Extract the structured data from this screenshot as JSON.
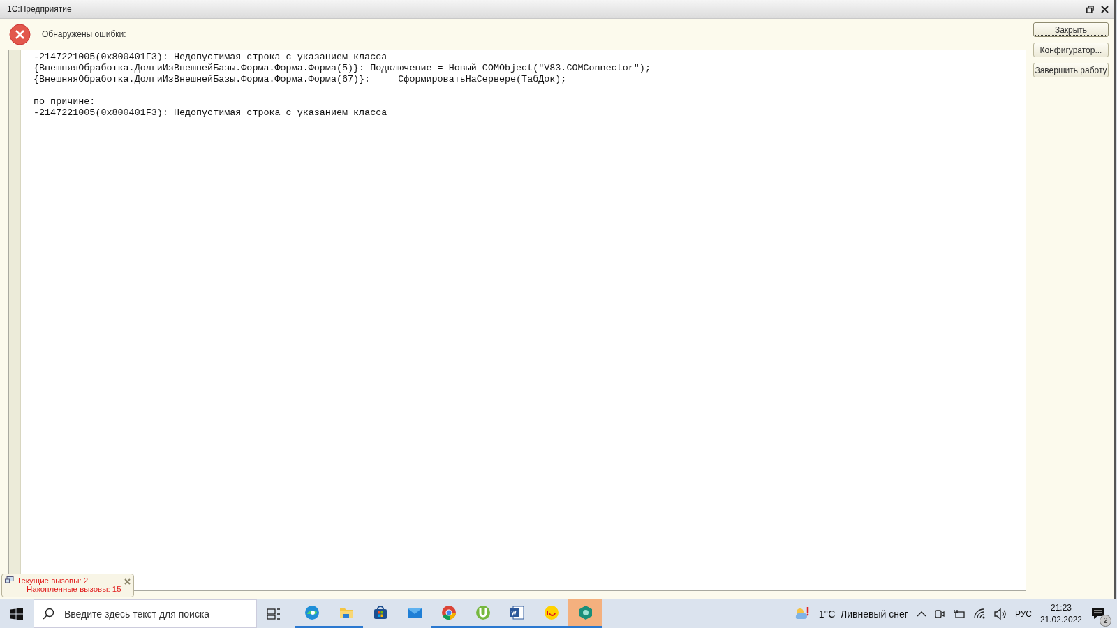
{
  "window": {
    "title": "1С:Предприятие"
  },
  "header": {
    "message": "Обнаружены ошибки:"
  },
  "error_text": {
    "paragraphs": [
      [
        "-2147221005(0x800401F3): Недопустимая строка с указанием класса",
        "{ВнешняяОбработка.ДолгиИзВнешнейБазы.Форма.Форма.Форма(5)}: Подключение = Новый COMObject(\"V83.COMConnector\");",
        "{ВнешняяОбработка.ДолгиИзВнешнейБазы.Форма.Форма.Форма(67)}:     СформироватьНаСервере(ТабДок);"
      ],
      [
        "по причине:",
        "-2147221005(0x800401F3): Недопустимая строка с указанием класса"
      ]
    ]
  },
  "buttons": [
    {
      "label": "Закрыть",
      "focused": true
    },
    {
      "label": "Конфигуратор...",
      "focused": false
    },
    {
      "label": "Завершить работу",
      "focused": false
    }
  ],
  "calls_popup": {
    "lines": [
      "Текущие вызовы: 2",
      "Накопленные вызовы: 15"
    ]
  },
  "taskbar": {
    "search_placeholder": "Введите здесь текст для поиска",
    "apps": [
      {
        "running": true,
        "active": false
      },
      {
        "running": true,
        "active": false
      },
      {
        "running": false,
        "active": false
      },
      {
        "running": false,
        "active": false
      },
      {
        "running": true,
        "active": false
      },
      {
        "running": true,
        "active": false
      },
      {
        "running": true,
        "active": false
      },
      {
        "running": true,
        "active": false
      },
      {
        "running": true,
        "active": true
      }
    ],
    "weather": "1°C  Ливневый снег",
    "language": "РУС",
    "time": "21:23",
    "date": "21.02.2022",
    "notifications": "2"
  }
}
